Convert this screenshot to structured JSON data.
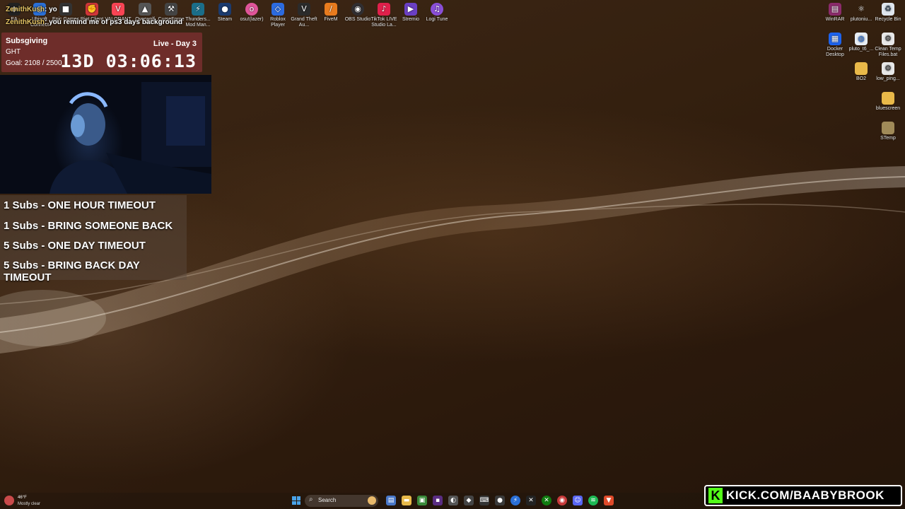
{
  "desktop_icons_top": [
    {
      "label": "EA",
      "icon": "ea-icon"
    },
    {
      "label": "Ubisoft Connect",
      "icon": "ubisoft-icon"
    },
    {
      "label": "Epic Games",
      "icon": "epic-games-icon"
    },
    {
      "label": "Riot Client",
      "icon": "riot-client-icon"
    },
    {
      "label": "VALORANT",
      "icon": "valorant-icon"
    },
    {
      "label": "Overwolf",
      "icon": "overwolf-icon"
    },
    {
      "label": "CurseForge",
      "icon": "curseforge-icon"
    },
    {
      "label": "Thunders... Mod Man...",
      "icon": "thunderstore-icon"
    },
    {
      "label": "Steam",
      "icon": "steam-icon"
    },
    {
      "label": "osu!(lazer)",
      "icon": "osu-icon"
    },
    {
      "label": "Roblox Player",
      "icon": "roblox-icon"
    },
    {
      "label": "Grand Theft Au...",
      "icon": "gta-icon"
    },
    {
      "label": "FiveM",
      "icon": "fivem-icon"
    },
    {
      "label": "OBS Studio",
      "icon": "obs-icon"
    },
    {
      "label": "TikTok LIVE Studio La...",
      "icon": "tiktok-icon"
    },
    {
      "label": "Stremio",
      "icon": "stremio-icon"
    },
    {
      "label": "Logi Tune",
      "icon": "logi-tune-icon"
    }
  ],
  "desktop_icons_right": [
    {
      "label": "WinRAR",
      "icon": "winrar-icon"
    },
    {
      "label": "plutoniu...",
      "icon": "plutonium-icon"
    },
    {
      "label": "Recycle Bin",
      "icon": "recycle-bin-icon"
    },
    {
      "label": "Docker Desktop",
      "icon": "docker-icon"
    },
    {
      "label": "pluto_t6_...",
      "icon": "file-icon"
    },
    {
      "label": "Clean Temp Files.bat",
      "icon": "bat-file-icon"
    },
    {
      "label": "BO2",
      "icon": "folder-icon"
    },
    {
      "label": "low_ping...",
      "icon": "file-icon"
    },
    {
      "label": "bluescreen",
      "icon": "folder-icon"
    },
    {
      "label": "STemp",
      "icon": "folder-icon"
    }
  ],
  "chat": [
    {
      "user": "ZenithKush",
      "message": "yo"
    },
    {
      "user": "ZenithKush",
      "message": "you remind me of ps3 days background"
    }
  ],
  "timer": {
    "title": "Subsgiving",
    "subtitle": "GHT",
    "goal": "Goal: 2108 / 2500",
    "live": "Live - Day 3",
    "countdown": "13D 03:06:13"
  },
  "rewards": [
    "1 Subs - ONE HOUR TIMEOUT",
    "1 Subs - BRING SOMEONE BACK",
    "5 Subs - ONE DAY TIMEOUT",
    "5 Subs - BRING BACK DAY TIMEOUT"
  ],
  "taskbar": {
    "weather_temp": "46°F",
    "weather_condition": "Mostly clear",
    "search_label": "Search",
    "search_icon": "search-icon",
    "start_icon": "windows-start-icon"
  },
  "kick_banner": {
    "logo_letter": "K",
    "url": "KICK.COM/BAABYBROOK"
  },
  "colors": {
    "timer_bg": "#6e2d2a",
    "kick_green": "#53fc18",
    "chat_user": "#e6c565"
  }
}
